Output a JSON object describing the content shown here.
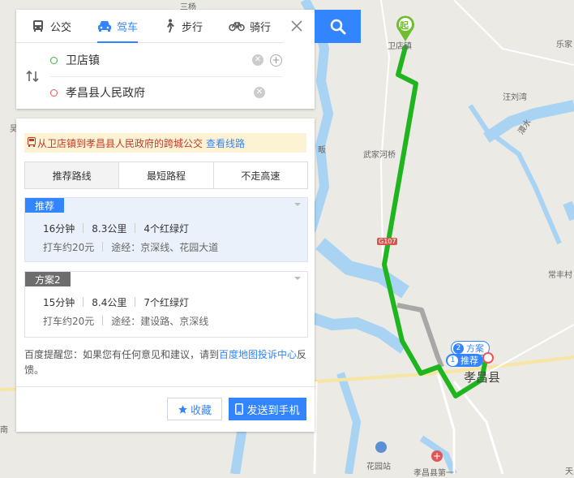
{
  "modes": [
    {
      "label": "公交",
      "icon": "bus-icon",
      "active": false
    },
    {
      "label": "驾车",
      "icon": "car-icon",
      "active": true
    },
    {
      "label": "步行",
      "icon": "walk-icon",
      "active": false
    },
    {
      "label": "骑行",
      "icon": "bike-icon",
      "active": false
    }
  ],
  "route": {
    "start": "卫店镇",
    "end": "孝昌县人民政府"
  },
  "notice": {
    "text": "从卫店镇到孝昌县人民政府的跨城公交",
    "link": "查看线路"
  },
  "tabs": [
    "推荐路线",
    "最短路程",
    "不走高速"
  ],
  "plans": [
    {
      "badge": "推荐",
      "time": "16分钟",
      "distance": "8.3公里",
      "lights": "4个红绿灯",
      "taxi": "打车约20元",
      "via": "途经：京深线、花园大道"
    },
    {
      "badge": "方案2",
      "time": "15分钟",
      "distance": "8.4公里",
      "lights": "7个红绿灯",
      "taxi": "打车约20元",
      "via": "途经：建设路、京深线"
    }
  ],
  "reminder": {
    "before": "百度提醒您：如果您有任何意见和建议，请到",
    "link": "百度地图投诉中心",
    "after": "反馈。"
  },
  "buttons": {
    "favorite": "收藏",
    "send": "发送到手机"
  },
  "map": {
    "labels": {
      "weidian": "卫店镇",
      "lejiawan": "乐家",
      "wangliuwan": "汪刘湾",
      "wujiahe": "武家河桥",
      "huanghe": "澴水",
      "changfeng": "常丰村",
      "xiaochang": "孝昌县",
      "huayuan": "花园站",
      "xiaochang_first": "孝昌县第一",
      "tian": "天",
      "fan": "畈",
      "sanyang": "三杨",
      "wu": "吴",
      "nan": "南"
    },
    "road_badge": "G107",
    "start_marker": "起",
    "callout_alt": "方案",
    "callout_alt_num": "2",
    "callout_rec": "推荐",
    "callout_rec_num": "1",
    "colors": {
      "route": "#1fb51f",
      "alt_route": "#a7a7a7",
      "water": "#a9d3f3",
      "accent": "#3385ff"
    }
  }
}
